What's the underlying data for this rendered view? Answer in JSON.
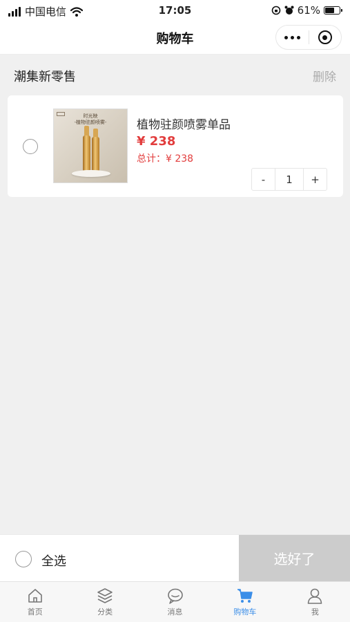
{
  "status_bar": {
    "carrier": "中国电信",
    "time": "17:05",
    "battery": "61%",
    "battery_level": 0.61
  },
  "nav": {
    "title": "购物车"
  },
  "store": {
    "name": "潮集新零售",
    "delete_label": "删除"
  },
  "item": {
    "name": "植物驻颜喷雾单品",
    "price": "¥ 238",
    "total": "总计：¥ 238",
    "quantity": "1",
    "decrease_label": "-",
    "increase_label": "+",
    "image_banner_line1": "时光映",
    "image_banner_line2": "-植物驻颜喷雾-"
  },
  "bottom_bar": {
    "select_all_label": "全选",
    "checkout_label": "选好了"
  },
  "tabbar": {
    "tabs": [
      {
        "label": "首页",
        "icon": "home-icon",
        "active": false
      },
      {
        "label": "分类",
        "icon": "layers-icon",
        "active": false
      },
      {
        "label": "消息",
        "icon": "chat-icon",
        "active": false
      },
      {
        "label": "购物车",
        "icon": "cart-icon",
        "active": true
      },
      {
        "label": "我",
        "icon": "user-icon",
        "active": false
      }
    ]
  },
  "colors": {
    "accent": "#3b8ee8",
    "price": "#e23d3d",
    "checkout_disabled": "#cccccc"
  }
}
